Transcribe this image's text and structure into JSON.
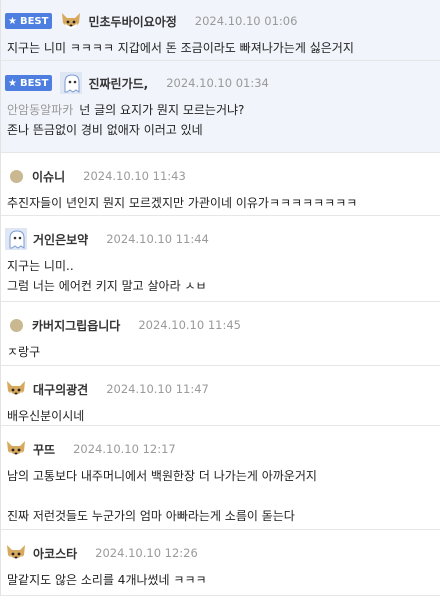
{
  "best_label": "BEST",
  "comments": [
    {
      "nick": "민초두바이요아정",
      "date": "2024.10.10 01:06",
      "lines": [
        "지구는 니미 ㅋㅋㅋㅋ 지갑에서 돈 조금이라도 빠져나가는게 싫은거지"
      ]
    },
    {
      "nick": "진짜린가드,",
      "date": "2024.10.10 01:34",
      "ref": "안암동알파카",
      "lines": [
        "넌 글의 요지가 뭔지 모르는거냐?",
        "존나 뜬금없이 경비 없애자 이러고 있네"
      ]
    },
    {
      "nick": "이슈니",
      "date": "2024.10.10 11:43",
      "lines": [
        "추진자들이 년인지 뭔지 모르겠지만 가관이네 이유가ㅋㅋㅋㅋㅋㅋㅋㅋ"
      ]
    },
    {
      "nick": "거인은보약",
      "date": "2024.10.10 11:44",
      "lines": [
        "지구는 니미..",
        "그럼 너는 에어컨 키지 말고 살아라 ㅅㅂ"
      ]
    },
    {
      "nick": "카버지그립읍니다",
      "date": "2024.10.10 11:45",
      "lines": [
        "ㅈ랑구"
      ]
    },
    {
      "nick": "대구의광견",
      "date": "2024.10.10 11:47",
      "lines": [
        "배우신분이시네"
      ]
    },
    {
      "nick": "꾸뜨",
      "date": "2024.10.10 12:17",
      "lines": [
        "남의 고통보다 내주머니에서 백원한장 더 나가는게 아까운거지",
        "진짜 저런것들도 누군가의 엄마 아빠라는게 소름이 돋는다"
      ]
    },
    {
      "nick": "아코스타",
      "date": "2024.10.10 12:26",
      "lines": [
        "말같지도 않은 소리를 4개나썼네 ㅋㅋㅋ"
      ]
    }
  ]
}
